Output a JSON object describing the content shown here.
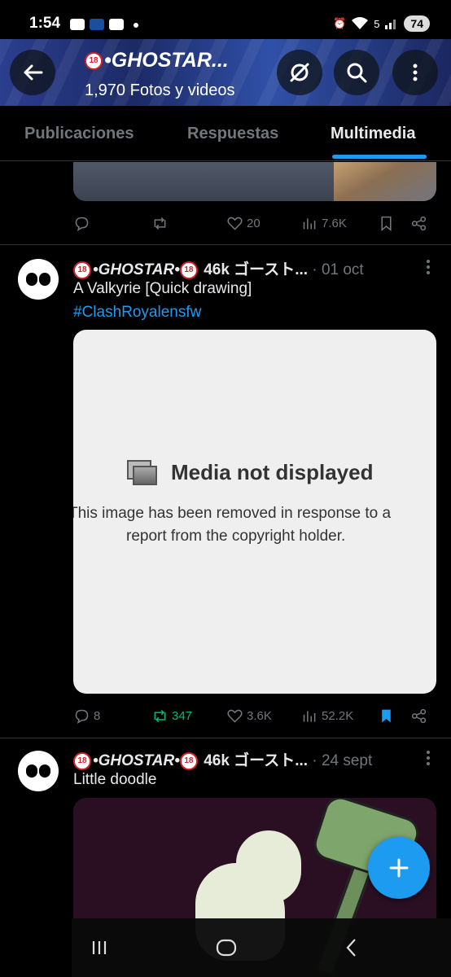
{
  "status_bar": {
    "time": "1:54",
    "battery": "74",
    "network": "5"
  },
  "header": {
    "title": "•GHOSTAR...",
    "title_badge": "18",
    "subtitle": "1,970 Fotos y videos",
    "icons": [
      "back-arrow-icon",
      "grok-icon",
      "search-icon",
      "more-vertical-icon"
    ]
  },
  "tabs": [
    {
      "label": "Publicaciones",
      "active": false
    },
    {
      "label": "Respuestas",
      "active": false
    },
    {
      "label": "Multimedia",
      "active": true
    }
  ],
  "tweets": [
    {
      "replies": "",
      "retweets": "",
      "likes": "20",
      "views": "7.6K",
      "bookmarked": false
    },
    {
      "author": "•GHOSTAR•",
      "badge": "18",
      "author_suffix": "46k ゴースト...",
      "date": "· 01 oct",
      "text": "A Valkyrie [Quick drawing]",
      "hashtag": "#ClashRoyalensfw",
      "media": {
        "heading": "Media not displayed",
        "line1": "This image has been removed in response to a",
        "line2": "report from the copyright holder."
      },
      "replies": "8",
      "retweets": "347",
      "likes": "3.6K",
      "views": "52.2K",
      "bookmarked": true
    },
    {
      "author": "•GHOSTAR•",
      "badge": "18",
      "author_suffix": "46k ゴースト...",
      "date": "· 24 sept",
      "text": "Little doodle"
    }
  ],
  "colors": {
    "accent": "#1d9bf0",
    "retweet": "#00ba7c",
    "muted": "#71767b",
    "text": "#e7e9ea",
    "background": "#000000"
  }
}
